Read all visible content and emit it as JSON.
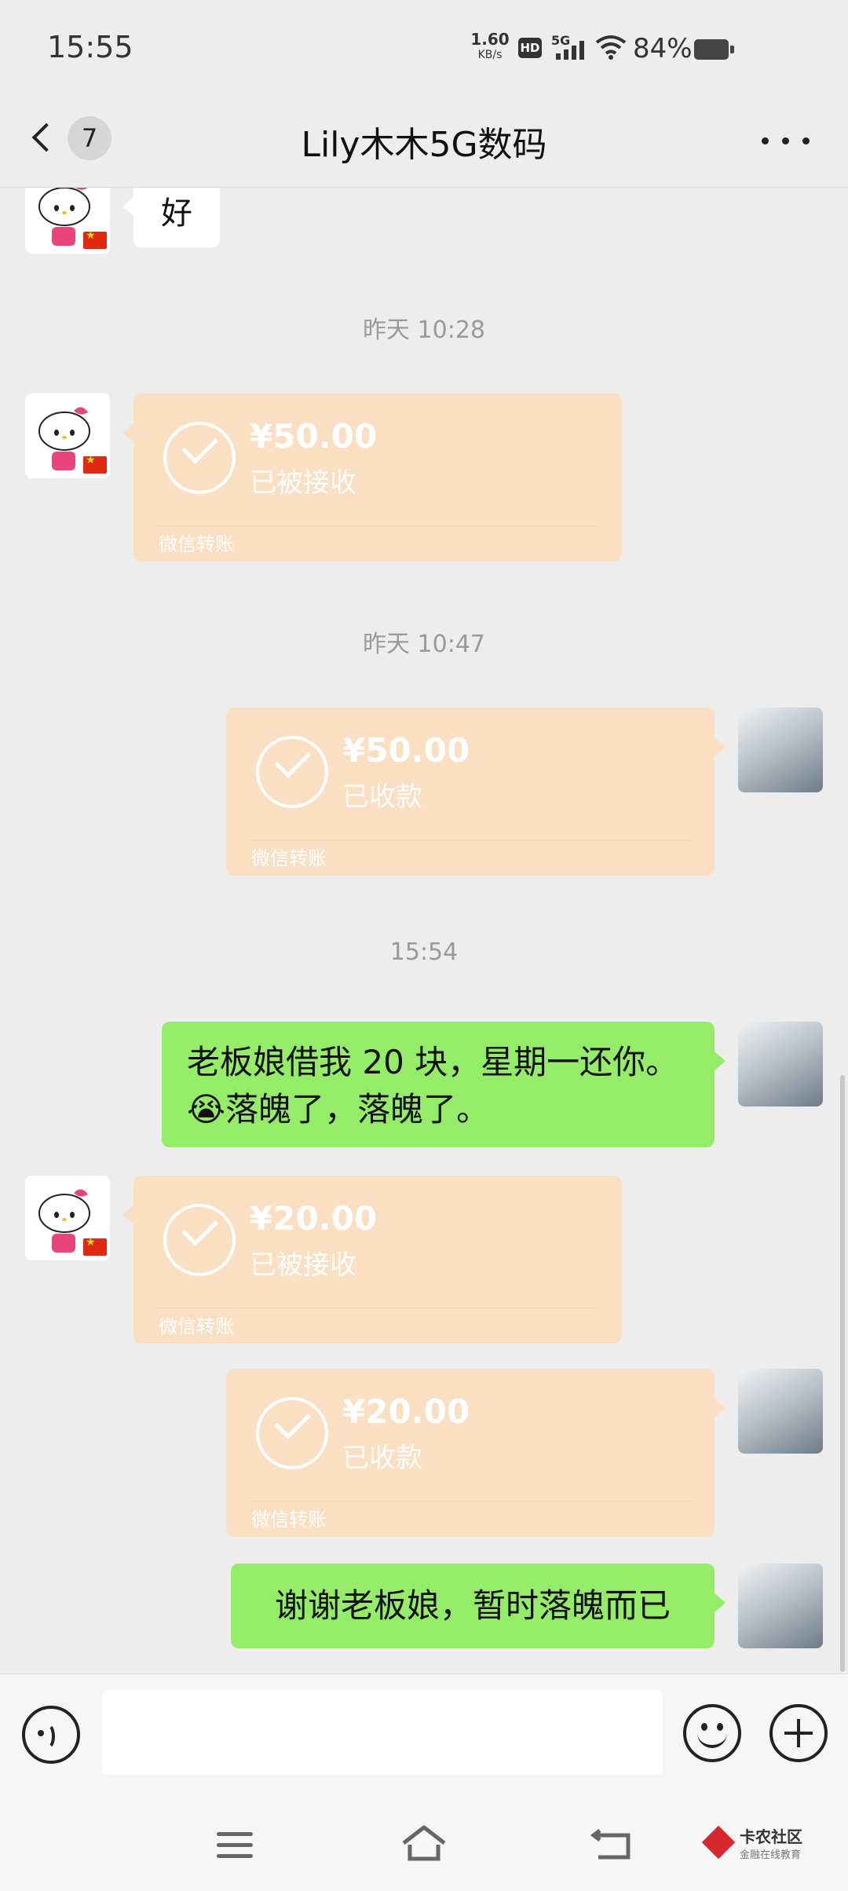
{
  "status_bar": {
    "time": "15:55",
    "net_speed_value": "1.60",
    "net_speed_unit": "KB/s",
    "hd_label": "HD",
    "network_label": "5G",
    "battery_percent": "84%",
    "battery_level": 0.84
  },
  "header": {
    "unread_count": "7",
    "title": "Lily木木5G数码"
  },
  "messages": [
    {
      "type": "text",
      "side": "left",
      "text": "好"
    },
    {
      "type": "time",
      "text": "昨天 10:28"
    },
    {
      "type": "transfer",
      "side": "left",
      "amount": "¥50.00",
      "status": "已被接收",
      "label": "微信转账"
    },
    {
      "type": "time",
      "text": "昨天 10:47"
    },
    {
      "type": "transfer",
      "side": "right",
      "amount": "¥50.00",
      "status": "已收款",
      "label": "微信转账"
    },
    {
      "type": "time",
      "text": "15:54"
    },
    {
      "type": "text",
      "side": "right",
      "line1": "老板娘借我 20 块，星期一还你。",
      "emoji": "😭",
      "line2": "落魄了，落魄了。"
    },
    {
      "type": "transfer",
      "side": "left",
      "amount": "¥20.00",
      "status": "已被接收",
      "label": "微信转账"
    },
    {
      "type": "transfer",
      "side": "right",
      "amount": "¥20.00",
      "status": "已收款",
      "label": "微信转账"
    },
    {
      "type": "text",
      "side": "right",
      "text": "谢谢老板娘，暂时落魄而已"
    }
  ],
  "watermark": {
    "title": "卡农社区",
    "subtitle": "金融在线教育"
  },
  "colors": {
    "background": "#ededed",
    "transfer_bubble": "#fbdfc3",
    "sent_bubble": "#95ec69",
    "received_bubble": "#ffffff"
  }
}
